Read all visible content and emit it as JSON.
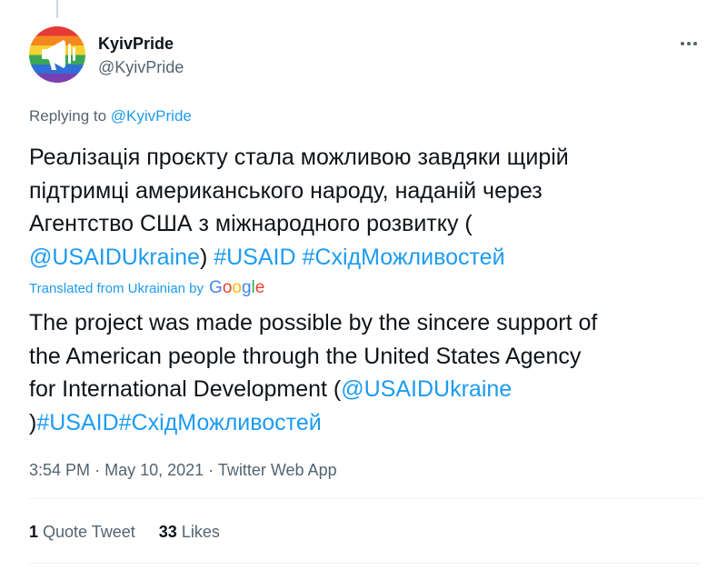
{
  "author": {
    "name": "KyivPride",
    "handle": "@KyivPride",
    "avatar_icon": "rainbow-megaphone-avatar"
  },
  "more_icon": "more-dots-icon",
  "replying": {
    "prefix": "Replying to",
    "target": "@KyivPride"
  },
  "tweet": {
    "line1": "Реалізація проєкту стала можливою завдяки щирій",
    "line2": "підтримці американського народу, наданій через",
    "line3": "Агентство США з міжнародного розвитку (",
    "mention": "@USAIDUkraine",
    "close_paren": ")",
    "hashtag1": "#USAID",
    "hashtag2": "#СхідМожливостей"
  },
  "translation": {
    "label": "Translated from Ukrainian by",
    "provider": "Google",
    "line1": "The project was made possible by the sincere support of",
    "line2": "the American people through the United States Agency",
    "line3_prefix": "for International Development (",
    "mention": "@USAIDUkraine",
    "close_paren": ")",
    "hashtag1": "#USAID",
    "hashtag2": "#СхідМожливостей"
  },
  "meta": {
    "time": "3:54 PM",
    "separator": "·",
    "date": "May 10, 2021",
    "source": "Twitter Web App"
  },
  "stats": {
    "quote_count": "1",
    "quote_label": "Quote Tweet",
    "likes_count": "33",
    "likes_label": "Likes"
  },
  "colors": {
    "link": "#1d9bf0",
    "text": "#0f1419",
    "secondary": "#536471",
    "divider": "#eff3f4"
  }
}
